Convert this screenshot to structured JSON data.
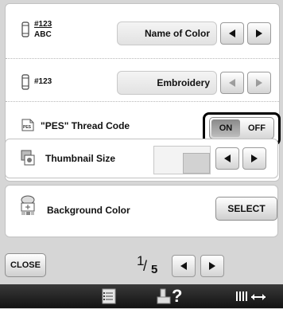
{
  "settings": {
    "thread_display": {
      "icon_code": "#123",
      "icon_name": "ABC",
      "value": "Name of Color",
      "icon": "spool-number-name-icon"
    },
    "embroidery": {
      "icon_code": "#123",
      "value": "Embroidery",
      "icon": "spool-icon"
    },
    "pes_thread_code": {
      "label": "\"PES\" Thread Code",
      "icon_text": "PES",
      "on_label": "ON",
      "off_label": "OFF",
      "selected": "ON"
    },
    "thumbnail_size": {
      "label": "Thumbnail Size"
    },
    "background_color": {
      "label": "Background Color",
      "button_label": "SELECT"
    }
  },
  "footer": {
    "close_label": "CLOSE",
    "page_current": "1",
    "page_total": "5"
  },
  "bottom_bar": {
    "icons": [
      "checklist-icon",
      "machine-help-icon",
      "thread-tension-icon"
    ],
    "help_glyph": "?"
  },
  "colors": {
    "highlight": "#000000",
    "panel_bg": "#ffffff",
    "page_bg": "#d6d6d6"
  }
}
